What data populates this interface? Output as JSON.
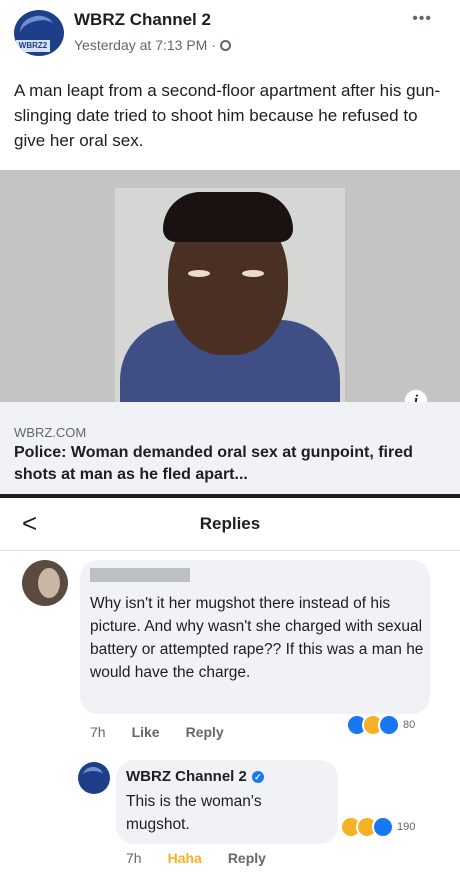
{
  "post": {
    "page_name": "WBRZ Channel 2",
    "avatar_tag": "WBRZ2",
    "timestamp": "Yesterday at 7:13 PM",
    "separator": "·",
    "more_label": "•••",
    "caption": "A man leapt from a second-floor apartment after his gun-slinging date tried to shoot him because he refused to give her oral sex.",
    "info_label": "i",
    "link": {
      "domain": "WBRZ.COM",
      "headline": "Police: Woman demanded oral sex at gunpoint, fired shots at man as he fled apart..."
    }
  },
  "replies": {
    "back_label": "<",
    "title": "Replies",
    "comment": {
      "text": "Why isn't it her mugshot there instead of his picture. And why wasn't she charged with sexual battery or attempted rape?? If this was a man he would have the charge.",
      "time": "7h",
      "like_label": "Like",
      "reply_label": "Reply",
      "reaction_count": "80",
      "reactions": [
        "like-icon",
        "haha-icon",
        "like-icon"
      ]
    },
    "reply": {
      "name": "WBRZ Channel 2",
      "text": "This is the woman's mugshot.",
      "time": "7h",
      "reaction_label": "Haha",
      "reply_label": "Reply",
      "reaction_count": "190",
      "reactions": [
        "haha-icon",
        "wow-icon",
        "like-icon"
      ]
    }
  },
  "colors": {
    "brand_blue": "#1d3f8a",
    "facebook_blue": "#1877f2",
    "bubble_bg": "#f0f2f5",
    "muted_text": "#65676b",
    "haha_color": "#f7b125"
  }
}
